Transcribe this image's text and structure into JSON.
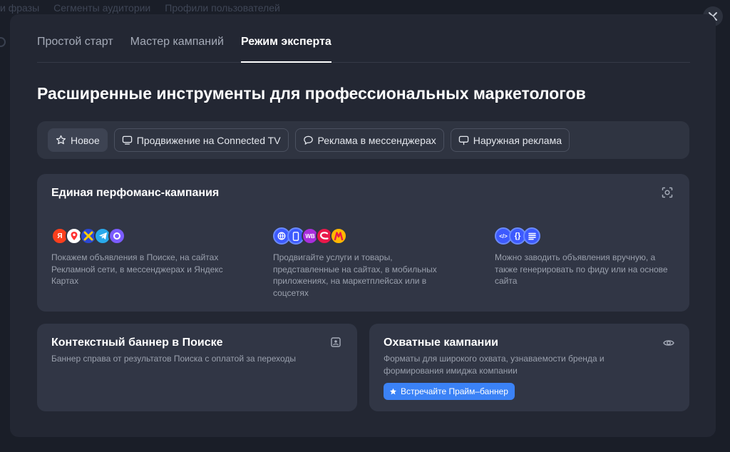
{
  "background": {
    "nav_items": [
      "и фразы",
      "Сегменты аудитории",
      "Профили пользователей"
    ]
  },
  "modal": {
    "tabs": [
      {
        "label": "Простой старт",
        "active": false
      },
      {
        "label": "Мастер кампаний",
        "active": false
      },
      {
        "label": "Режим эксперта",
        "active": true
      }
    ],
    "title": "Расширенные инструменты для профессиональных маркетологов",
    "chips": [
      {
        "label": "Новое",
        "icon": "star-icon",
        "active": true
      },
      {
        "label": "Продвижение на Connected TV",
        "icon": "tv-icon",
        "active": false
      },
      {
        "label": "Реклама в мессенджерах",
        "icon": "chat-bubble-icon",
        "active": false
      },
      {
        "label": "Наружная реклама",
        "icon": "billboard-icon",
        "active": false
      }
    ],
    "performance_card": {
      "title": "Единая перфоманс-кампания",
      "icon": "focus-target-icon",
      "columns": [
        {
          "logos": [
            {
              "name": "yandex-logo-icon",
              "text": "Я",
              "color": "#fc3f1d"
            },
            {
              "name": "map-pin-icon",
              "text": "",
              "color": "#ffffff"
            },
            {
              "name": "ad-network-icon",
              "text": "",
              "color": "#ffcc00"
            },
            {
              "name": "telegram-icon",
              "text": "",
              "color": "#29a9eb"
            },
            {
              "name": "max-messenger-icon",
              "text": "",
              "color": "#7b5cff"
            }
          ],
          "text": "Покажем объявления в Поиске, на сайтах Рекламной сети, в мессенджерах и Яндекс Картах"
        },
        {
          "logos": [
            {
              "name": "globe-icon",
              "text": "",
              "color": "#3d5afe"
            },
            {
              "name": "smartphone-icon",
              "text": "",
              "color": "#3d5afe"
            },
            {
              "name": "wildberries-icon",
              "text": "WB",
              "color": "#a92edb"
            },
            {
              "name": "sbermegamarket-icon",
              "text": "",
              "color": "#e9184a"
            },
            {
              "name": "yandex-market-icon",
              "text": "",
              "color": "#ffb800"
            }
          ],
          "text": "Продвигайте услуги и товары, представленные на сайтах, в мобильных приложениях, на маркетплейсах или в соцсетях"
        },
        {
          "logos": [
            {
              "name": "code-icon",
              "text": "</>",
              "color": "#3d5afe"
            },
            {
              "name": "braces-icon",
              "text": "{}",
              "color": "#3d5afe"
            },
            {
              "name": "document-list-icon",
              "text": "",
              "color": "#3d5afe"
            }
          ],
          "text": "Можно заводить объявления вручную, а также генерировать по фиду или на основе сайта"
        }
      ]
    },
    "banner_card": {
      "title": "Контекстный баннер в Поиске",
      "description": "Баннер справа от результатов Поиска с оплатой за переходы",
      "icon": "image-frame-icon"
    },
    "reach_card": {
      "title": "Охватные кампании",
      "description": "Форматы для широкого охвата, узнаваемости бренда и формирования имиджа компании",
      "icon": "eye-icon",
      "button_label": "Встречайте Прайм–баннер",
      "button_icon": "star-filled-icon"
    }
  },
  "colors": {
    "backdrop": "#1a1e28",
    "modal": "#232733",
    "card": "#313645",
    "accent": "#3b82f6"
  }
}
